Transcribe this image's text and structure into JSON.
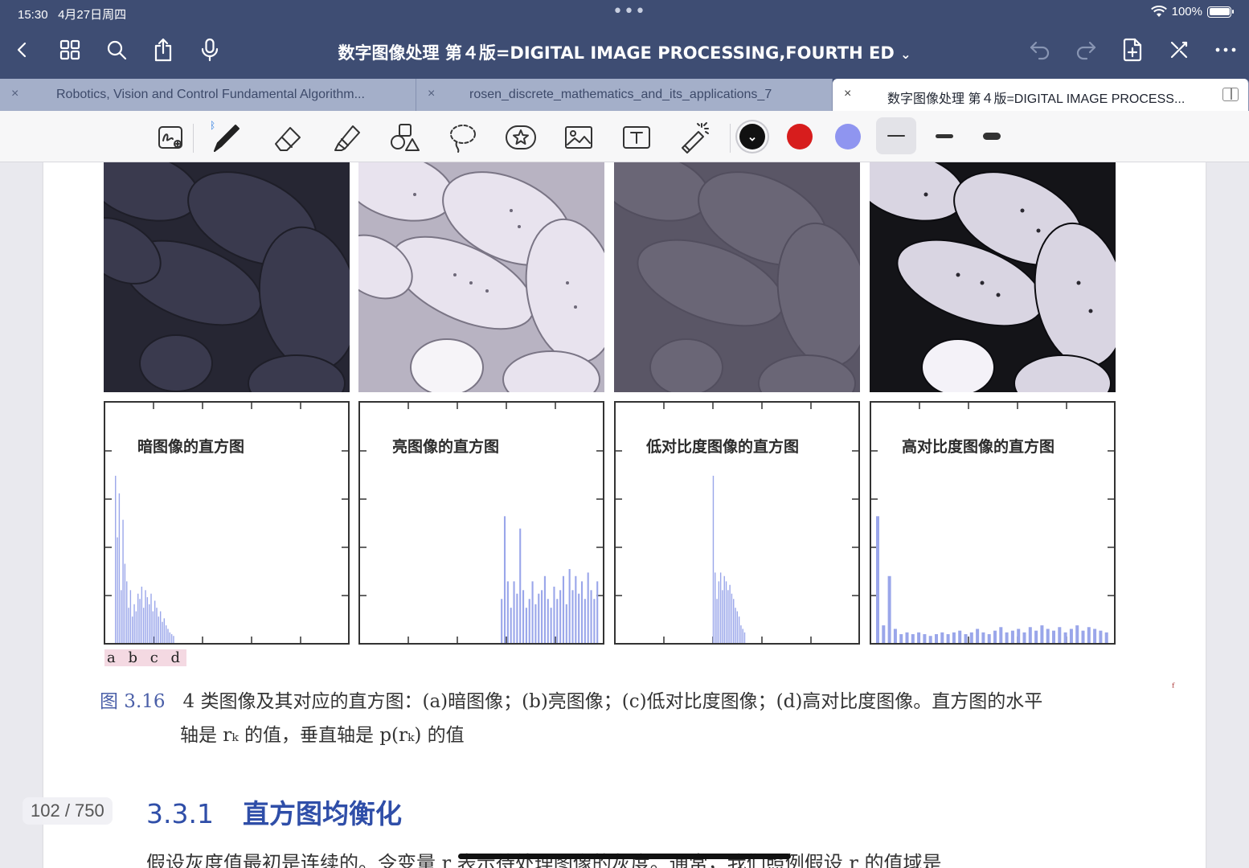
{
  "status_bar": {
    "time": "15:30",
    "date": "4月27日周四",
    "battery": "100%",
    "dots": "•••"
  },
  "header": {
    "title": "数字图像处理  第４版=DIGITAL  IMAGE  PROCESSING,FOURTH  ED",
    "title_chevron": "⌄",
    "left_icons": [
      "back-icon",
      "grid-icon",
      "search-icon",
      "share-icon",
      "microphone-icon"
    ],
    "right_icons": [
      "undo-icon",
      "redo-icon",
      "add-page-icon",
      "close-pen-icon",
      "more-icon"
    ]
  },
  "tabs": [
    {
      "label": "Robotics, Vision and Control Fundamental Algorithm...",
      "close": "×"
    },
    {
      "label": "rosen_discrete_mathematics_and_its_applications_7",
      "close": "×"
    },
    {
      "label": "数字图像处理  第４版=DIGITAL  IMAGE  PROCESS...",
      "close": "×",
      "active": true
    }
  ],
  "toolbar": {
    "tools": [
      "handwriting-add-icon",
      "pen-icon",
      "eraser-icon",
      "highlighter-icon",
      "shapes-icon",
      "lasso-icon",
      "sticker-icon",
      "image-icon",
      "text-icon",
      "laser-pointer-icon"
    ],
    "colors": [
      "#111111",
      "#d71d1d",
      "#8f95f0"
    ],
    "selected_color": "#111111",
    "stroke_widths": [
      "thin",
      "medium",
      "thick"
    ],
    "selected_stroke": "thin"
  },
  "figure": {
    "hist_titles": [
      "暗图像的直方图",
      "亮图像的直方图",
      "低对比度图像的直方图",
      "高对比度图像的直方图"
    ],
    "panel_letters": "a b c d",
    "caption_label": "图 3.16",
    "caption_line1": "4 类图像及其对应的直方图：(a)暗图像；(b)亮图像；(c)低对比度图像；(d)高对比度图像。直方图的水平",
    "caption_line2": "轴是 rₖ 的值，垂直轴是 p(rₖ) 的值"
  },
  "chart_data": [
    {
      "type": "bar",
      "title": "暗图像的直方图",
      "description_range": [
        0.02,
        0.3
      ],
      "values": [
        0.95,
        0.6,
        0.85,
        0.3,
        0.7,
        0.45,
        0.35,
        0.2,
        0.3,
        0.15,
        0.22,
        0.18,
        0.28,
        0.25,
        0.32,
        0.2,
        0.3,
        0.26,
        0.22,
        0.28,
        0.18,
        0.24,
        0.2,
        0.15,
        0.18,
        0.12,
        0.14,
        0.1,
        0.08,
        0.06,
        0.05,
        0.04
      ]
    },
    {
      "type": "bar",
      "title": "亮图像的直方图",
      "description_range": [
        0.56,
        1.0
      ],
      "values": [
        0.25,
        0.72,
        0.35,
        0.2,
        0.35,
        0.28,
        0.65,
        0.3,
        0.2,
        0.25,
        0.35,
        0.22,
        0.28,
        0.3,
        0.38,
        0.25,
        0.2,
        0.32,
        0.25,
        0.3,
        0.38,
        0.22,
        0.42,
        0.3,
        0.38,
        0.28,
        0.35,
        0.25,
        0.4,
        0.3,
        0.25,
        0.35
      ]
    },
    {
      "type": "bar",
      "title": "低对比度图像的直方图",
      "description_range": [
        0.38,
        0.55
      ],
      "values": [
        0.95,
        0.4,
        0.25,
        0.35,
        0.4,
        0.3,
        0.38,
        0.35,
        0.3,
        0.33,
        0.28,
        0.25,
        0.2,
        0.18,
        0.15,
        0.1,
        0.08,
        0.06
      ]
    },
    {
      "type": "bar",
      "title": "高对比度图像的直方图",
      "description_range": [
        0.0,
        1.0
      ],
      "values": [
        0.72,
        0.1,
        0.38,
        0.08,
        0.05,
        0.06,
        0.05,
        0.06,
        0.05,
        0.04,
        0.05,
        0.06,
        0.05,
        0.06,
        0.07,
        0.05,
        0.06,
        0.08,
        0.06,
        0.05,
        0.07,
        0.09,
        0.06,
        0.07,
        0.08,
        0.06,
        0.09,
        0.07,
        0.1,
        0.08,
        0.07,
        0.09,
        0.06,
        0.08,
        0.1,
        0.07,
        0.09,
        0.08,
        0.07,
        0.06
      ]
    }
  ],
  "section": {
    "number": "3.3.1",
    "title": "直方图均衡化",
    "body": "假设灰度值最初是连续的。令变量 r 表示待处理图像的灰度。通常，我们照例假设 r 的值域是"
  },
  "page_indicator": "102 / 750",
  "margin_mark": "ᶠ"
}
